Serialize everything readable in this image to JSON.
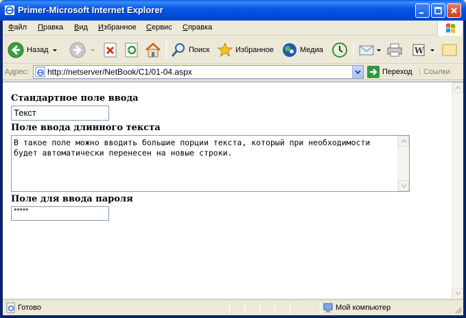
{
  "window": {
    "title": "Primer-Microsoft Internet Explorer"
  },
  "menu": [
    "Файл",
    "Правка",
    "Вид",
    "Избранное",
    "Сервис",
    "Справка"
  ],
  "toolbar": {
    "back_label": "Назад",
    "search_label": "Поиск",
    "favorites_label": "Избранное",
    "media_label": "Медиа"
  },
  "address": {
    "label": "Адрес:",
    "url": "http://netserver/NetBook/C1/01-04.aspx",
    "go_label": "Переход",
    "links_label": "Ссылки"
  },
  "page": {
    "field1_label": "Стандартное поле ввода",
    "field1_value": "Текст",
    "field2_label": "Поле ввода длинного текста",
    "field2_value": "В такое поле можно вводить большие порции текста, который при необходимости будет автоматически перенесен на новые строки.",
    "field3_label": "Поле для ввода пароля",
    "field3_value": "*****"
  },
  "status": {
    "text": "Готово",
    "zone": "Мой компьютер"
  },
  "colors": {
    "titlebar": "#0958e6",
    "chrome": "#ece9d8",
    "input_border": "#7f9db9"
  }
}
